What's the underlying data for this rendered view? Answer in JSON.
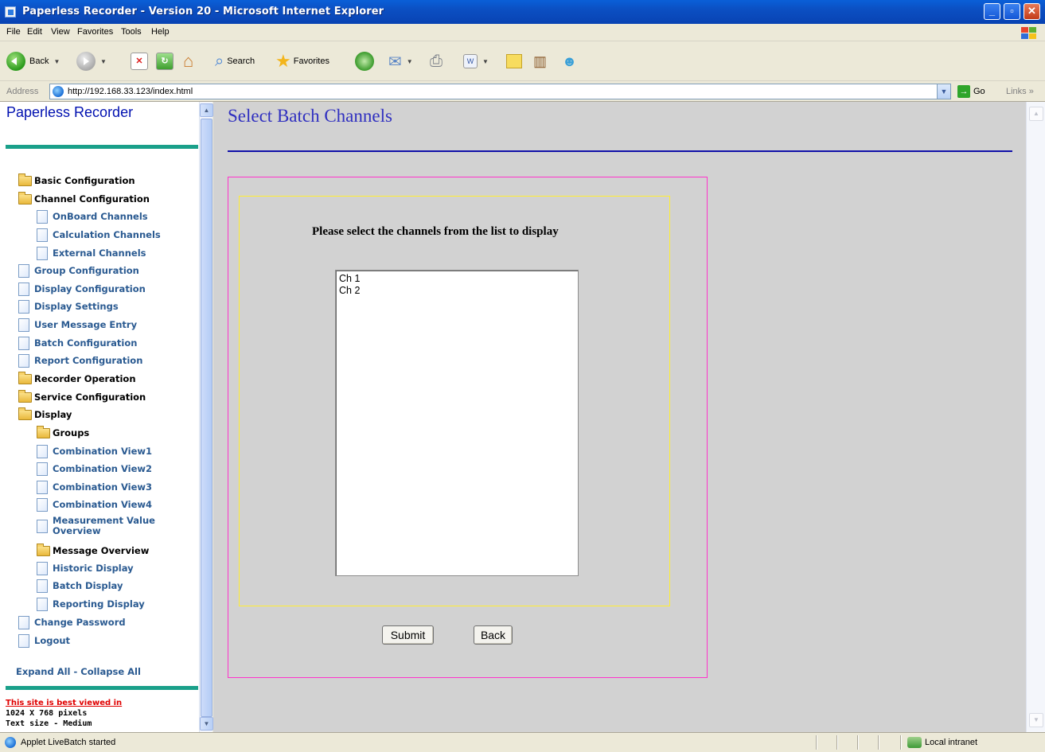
{
  "window": {
    "title": "Paperless Recorder - Version 20 - Microsoft Internet Explorer"
  },
  "menu": [
    "File",
    "Edit",
    "View",
    "Favorites",
    "Tools",
    "Help"
  ],
  "toolbar": {
    "back_label": "Back",
    "search_label": "Search",
    "favorites_label": "Favorites"
  },
  "address": {
    "label": "Address",
    "url": "http://192.168.33.123/index.html",
    "go_label": "Go",
    "links_label": "Links"
  },
  "sidebar": {
    "title": "Paperless Recorder",
    "items": [
      {
        "label": "Basic Configuration",
        "icon": "folder-icon",
        "link": false,
        "level": 0
      },
      {
        "label": "Channel Configuration",
        "icon": "folder-open-icon",
        "link": false,
        "level": 0
      },
      {
        "label": "OnBoard Channels",
        "icon": "document-icon",
        "link": true,
        "level": 1
      },
      {
        "label": "Calculation Channels",
        "icon": "document-icon",
        "link": true,
        "level": 1
      },
      {
        "label": "External Channels",
        "icon": "document-icon",
        "link": true,
        "level": 1
      },
      {
        "label": "Group Configuration",
        "icon": "document-icon",
        "link": true,
        "level": 0
      },
      {
        "label": "Display Configuration",
        "icon": "document-icon",
        "link": true,
        "level": 0
      },
      {
        "label": "Display Settings",
        "icon": "document-icon",
        "link": true,
        "level": 0
      },
      {
        "label": "User Message Entry",
        "icon": "document-icon",
        "link": true,
        "level": 0
      },
      {
        "label": "Batch Configuration",
        "icon": "document-icon",
        "link": true,
        "level": 0
      },
      {
        "label": "Report Configuration",
        "icon": "document-icon",
        "link": true,
        "level": 0
      },
      {
        "label": "Recorder Operation",
        "icon": "folder-icon",
        "link": false,
        "level": 0
      },
      {
        "label": "Service Configuration",
        "icon": "folder-icon",
        "link": false,
        "level": 0
      },
      {
        "label": "Display",
        "icon": "folder-open-icon",
        "link": false,
        "level": 0
      },
      {
        "label": "Groups",
        "icon": "folder-icon",
        "link": false,
        "level": 1
      },
      {
        "label": "Combination View1",
        "icon": "document-icon",
        "link": true,
        "level": 1
      },
      {
        "label": "Combination View2",
        "icon": "document-icon",
        "link": true,
        "level": 1
      },
      {
        "label": "Combination View3",
        "icon": "document-icon",
        "link": true,
        "level": 1
      },
      {
        "label": "Combination View4",
        "icon": "document-icon",
        "link": true,
        "level": 1
      },
      {
        "label": "Measurement Value Overview",
        "icon": "document-icon",
        "link": true,
        "level": 1
      },
      {
        "label": "Message Overview",
        "icon": "folder-icon",
        "link": false,
        "level": 1
      },
      {
        "label": "Historic Display",
        "icon": "document-icon",
        "link": true,
        "level": 1
      },
      {
        "label": "Batch Display",
        "icon": "document-icon",
        "link": true,
        "level": 1
      },
      {
        "label": "Reporting Display",
        "icon": "document-icon",
        "link": true,
        "level": 1
      },
      {
        "label": "Change Password",
        "icon": "document-icon",
        "link": true,
        "level": 0
      },
      {
        "label": "Logout",
        "icon": "document-icon",
        "link": true,
        "level": 0
      }
    ],
    "expand_collapse": "Expand All - Collapse All",
    "best_viewed": "This site is best viewed in",
    "resolution": "1024 X 768 pixels",
    "text_size": "Text size - Medium"
  },
  "main": {
    "title": "Select Batch Channels",
    "prompt": "Please select the channels from the list to display",
    "channels": [
      "Ch 1",
      "Ch 2"
    ],
    "submit_label": "Submit",
    "back_label": "Back"
  },
  "status": {
    "text": "Applet LiveBatch started",
    "zone": "Local intranet"
  },
  "colors": {
    "title_bar": "#0b4fc2",
    "sidebar_link": "#2a5a91",
    "sidebar_rule": "#1aa08a",
    "page_title": "#3030c0",
    "outer_border": "#ff33cc",
    "inner_border": "#ffee33",
    "main_bg": "#d2d2d2"
  }
}
